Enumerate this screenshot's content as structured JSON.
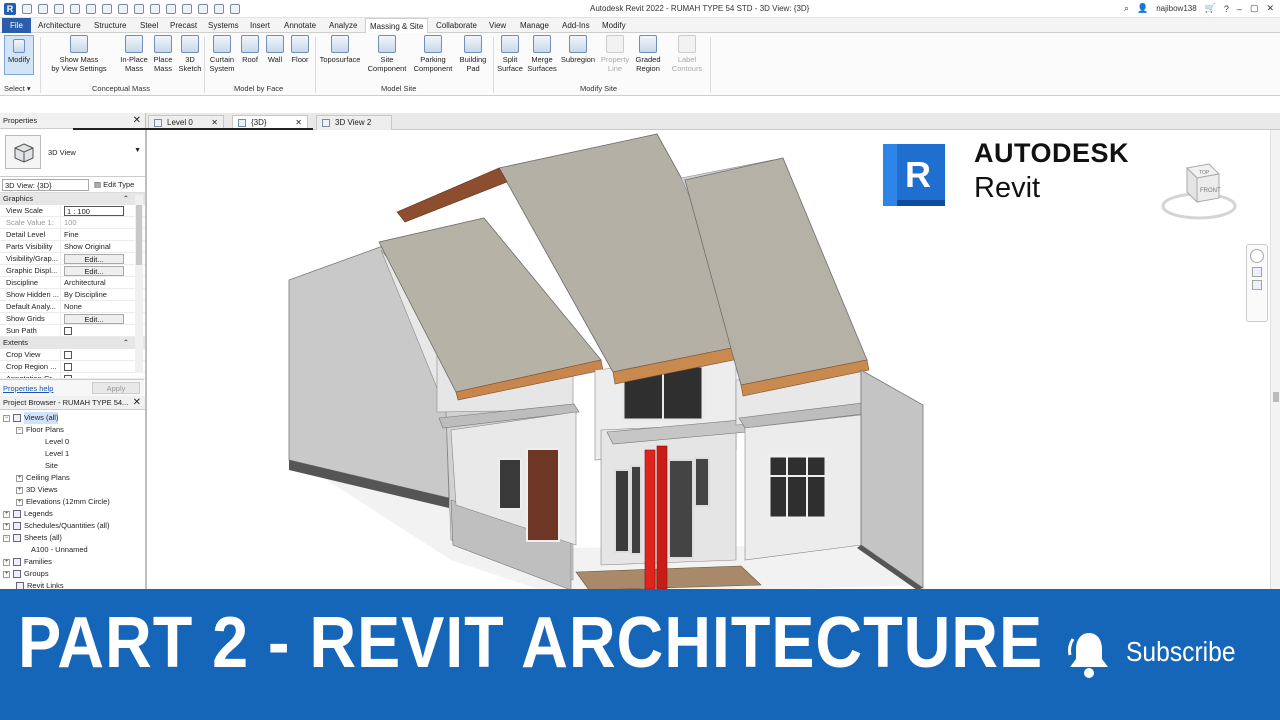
{
  "window": {
    "title": "Autodesk Revit 2022 - RUMAH TYPE 54 STD - 3D View: {3D}",
    "user": "najibow138"
  },
  "ribbon_tabs": [
    "File",
    "Architecture",
    "Structure",
    "Steel",
    "Precast",
    "Systems",
    "Insert",
    "Annotate",
    "Analyze",
    "Massing & Site",
    "Collaborate",
    "View",
    "Manage",
    "Add-Ins",
    "Modify"
  ],
  "active_tab": "Massing & Site",
  "ribbon": {
    "modify": "Modify",
    "select_label": "Select ▾",
    "conceptual_mass": {
      "label": "Conceptual Mass",
      "show_mass_1": "Show Mass",
      "show_mass_2": "by View Settings",
      "inplace_1": "In-Place",
      "inplace_2": "Mass",
      "place_1": "Place",
      "place_2": "Mass",
      "sketch_1": "3D",
      "sketch_2": "Sketch"
    },
    "model_by_face": {
      "label": "Model by Face",
      "curtain_1": "Curtain",
      "curtain_2": "System",
      "roof": "Roof",
      "wall": "Wall",
      "floor": "Floor"
    },
    "model_site": {
      "label": "Model Site",
      "toposurface": "Toposurface",
      "site_comp_1": "Site",
      "site_comp_2": "Component",
      "parking_1": "Parking",
      "parking_2": "Component",
      "pad_1": "Building",
      "pad_2": "Pad"
    },
    "modify_site": {
      "label": "Modify Site",
      "split_1": "Split",
      "split_2": "Surface",
      "merge_1": "Merge",
      "merge_2": "Surfaces",
      "subregion": "Subregion",
      "propline_1": "Property",
      "propline_2": "Line",
      "graded_1": "Graded",
      "graded_2": "Region",
      "label_1": "Label",
      "label_2": "Contours"
    }
  },
  "properties": {
    "title": "Properties",
    "type_name": "3D View",
    "view_selector": "3D View: {3D}",
    "edit_type": "Edit Type",
    "sections": {
      "graphics": "Graphics",
      "extents": "Extents"
    },
    "rows": [
      {
        "k": "View Scale",
        "v": "1 : 100"
      },
      {
        "k": "Scale Value    1:",
        "v": "100"
      },
      {
        "k": "Detail Level",
        "v": "Fine"
      },
      {
        "k": "Parts Visibility",
        "v": "Show Original"
      },
      {
        "k": "Visibility/Grap...",
        "v": "Edit..."
      },
      {
        "k": "Graphic Displ...",
        "v": "Edit..."
      },
      {
        "k": "Discipline",
        "v": "Architectural"
      },
      {
        "k": "Show Hidden ...",
        "v": "By Discipline"
      },
      {
        "k": "Default Analy...",
        "v": "None"
      },
      {
        "k": "Show Grids",
        "v": "Edit..."
      },
      {
        "k": "Sun Path",
        "v": ""
      },
      {
        "k": "Crop View",
        "v": ""
      },
      {
        "k": "Crop Region ...",
        "v": ""
      },
      {
        "k": "Annotation Cr...",
        "v": ""
      }
    ],
    "help": "Properties help",
    "apply": "Apply"
  },
  "browser": {
    "title": "Project Browser - RUMAH TYPE 54...",
    "nodes": [
      {
        "t": "Views (all)"
      },
      {
        "t": "Floor Plans"
      },
      {
        "t": "Level 0"
      },
      {
        "t": "Level 1"
      },
      {
        "t": "Site"
      },
      {
        "t": "Ceiling Plans"
      },
      {
        "t": "3D Views"
      },
      {
        "t": "Elevations (12mm Circle)"
      },
      {
        "t": "Legends"
      },
      {
        "t": "Schedules/Quantities (all)"
      },
      {
        "t": "Sheets (all)"
      },
      {
        "t": "A100 - Unnamed"
      },
      {
        "t": "Families"
      },
      {
        "t": "Groups"
      },
      {
        "t": "Revit Links"
      }
    ]
  },
  "view_tabs": [
    "Level 0",
    "{3D}",
    "3D View 2"
  ],
  "logo": {
    "brand": "AUTODESK",
    "product": "Revit",
    "letter": "R"
  },
  "viewcube": {
    "top": "TOP",
    "front": "FRONT"
  },
  "banner": {
    "headline": "PART 2 - REVIT  ARCHITECTURE",
    "subscribe": "Subscribe"
  },
  "colors": {
    "banner": "#1565b9",
    "roof": "#b5b0a4",
    "fascia": "#c98a4f",
    "column": "#e0231b",
    "revit_blue": "#1f6fd1"
  }
}
